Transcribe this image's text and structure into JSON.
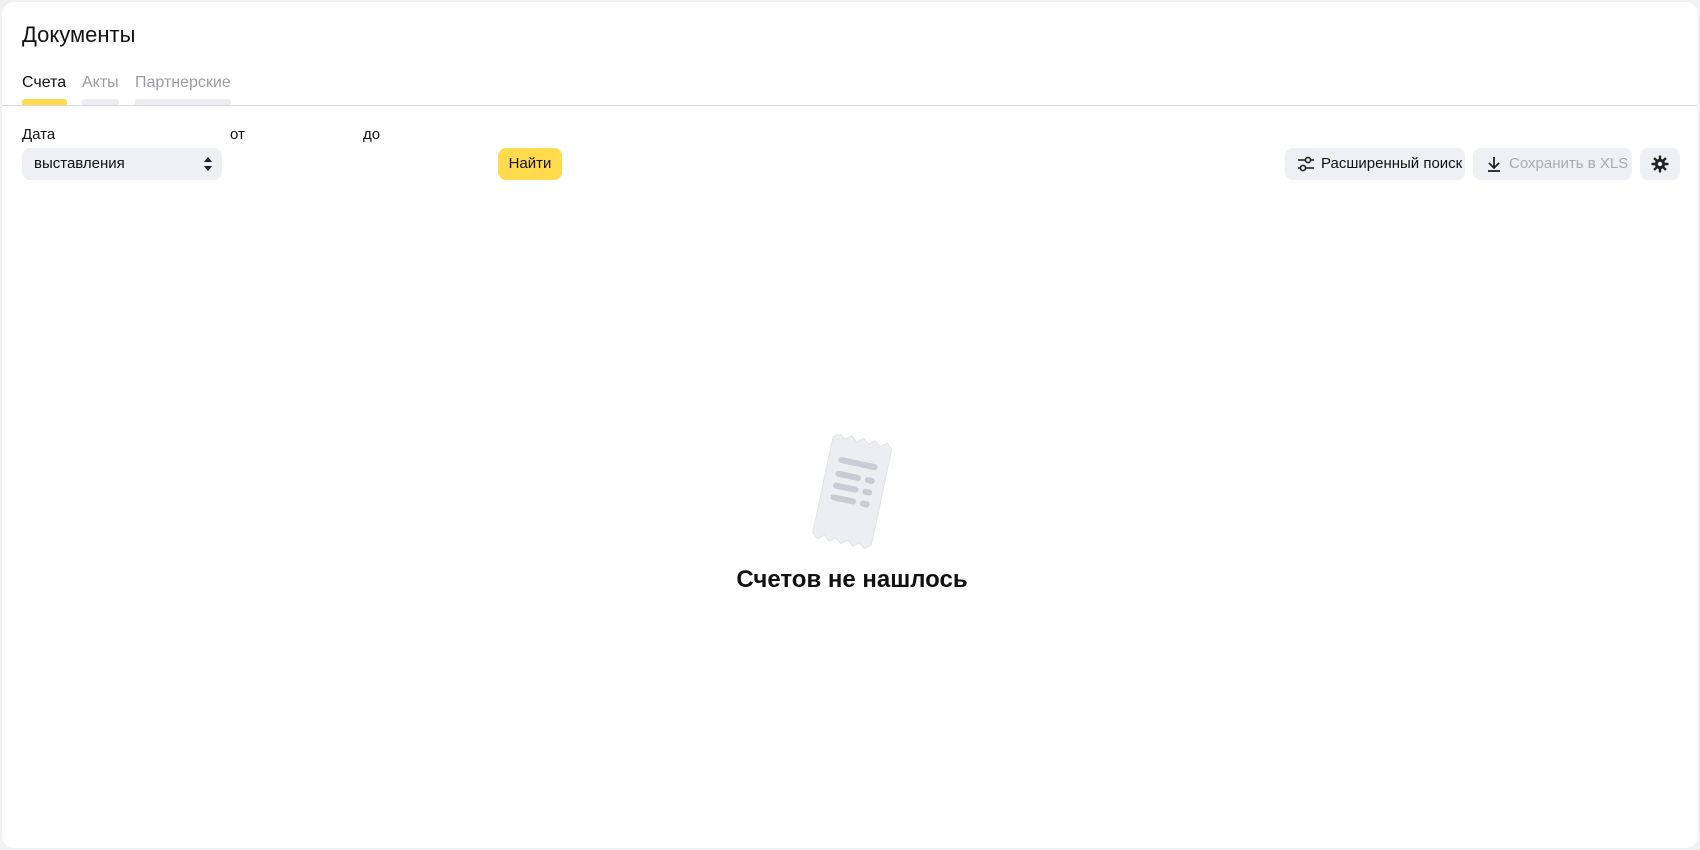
{
  "page": {
    "title": "Документы"
  },
  "tabs": [
    {
      "label": "Счета",
      "active": true
    },
    {
      "label": "Акты",
      "active": false
    },
    {
      "label": "Партнерские",
      "active": false
    }
  ],
  "filters": {
    "date_label": "Дата",
    "date_type_value": "выставления",
    "from_label": "от",
    "to_label": "до",
    "find_button": "Найти"
  },
  "toolbar": {
    "advanced_search_label": "Расширенный поиск",
    "advanced_search_icon": "sliders-icon",
    "save_xls_label": "Сохранить в XLS",
    "save_xls_icon": "download-icon",
    "settings_icon": "gear-icon"
  },
  "empty_state": {
    "illustration_icon": "receipt-icon",
    "title": "Счетов не нашлось"
  },
  "colors": {
    "accent": "#ffdb4d",
    "button_bg": "#eef0f3",
    "inactive_text": "#9a9ca6",
    "disabled_text": "#a8abb3"
  }
}
